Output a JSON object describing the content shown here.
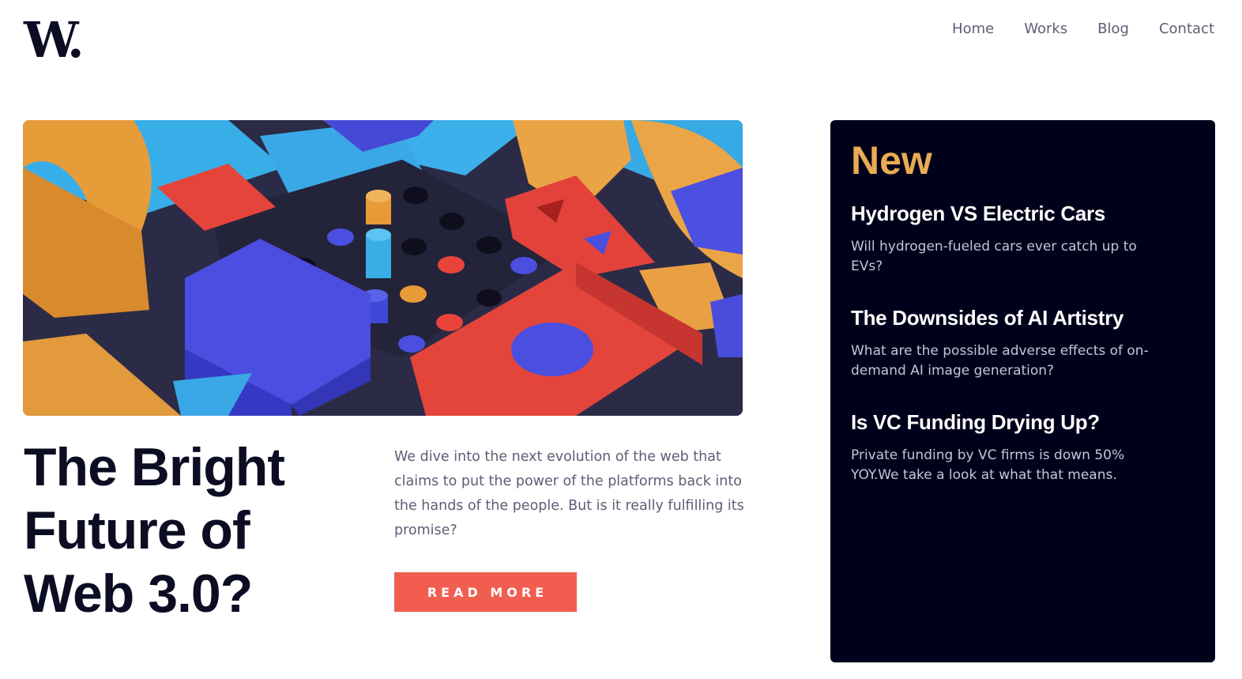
{
  "logo": {
    "text": "W."
  },
  "nav": {
    "items": [
      {
        "label": "Home"
      },
      {
        "label": "Works"
      },
      {
        "label": "Blog"
      },
      {
        "label": "Contact"
      }
    ]
  },
  "hero": {
    "image_icon": "abstract-blocks-illustration",
    "headline": "The Bright Future of Web 3.0?",
    "intro": "We dive into the next evolution of the web that claims to put the power of the platforms back into the hands of the people. But is it really fulfilling its promise?",
    "cta_label": "READ MORE"
  },
  "new_panel": {
    "title": "New",
    "items": [
      {
        "title": "Hydrogen VS Electric Cars",
        "desc": "Will hydrogen-fueled cars ever catch up to EVs?"
      },
      {
        "title": "The Downsides of AI Artistry",
        "desc": "What are the possible adverse effects of on-demand AI image generation?"
      },
      {
        "title": "Is VC Funding Drying Up?",
        "desc": "Private funding by VC firms is down 50% YOY.We take a look at what that means."
      }
    ]
  },
  "colors": {
    "accent": "#f15e50",
    "new_title": "#e9ab53",
    "panel_bg": "#00001a",
    "text_dark": "#0c0d23",
    "text_muted": "#5c5e75"
  }
}
